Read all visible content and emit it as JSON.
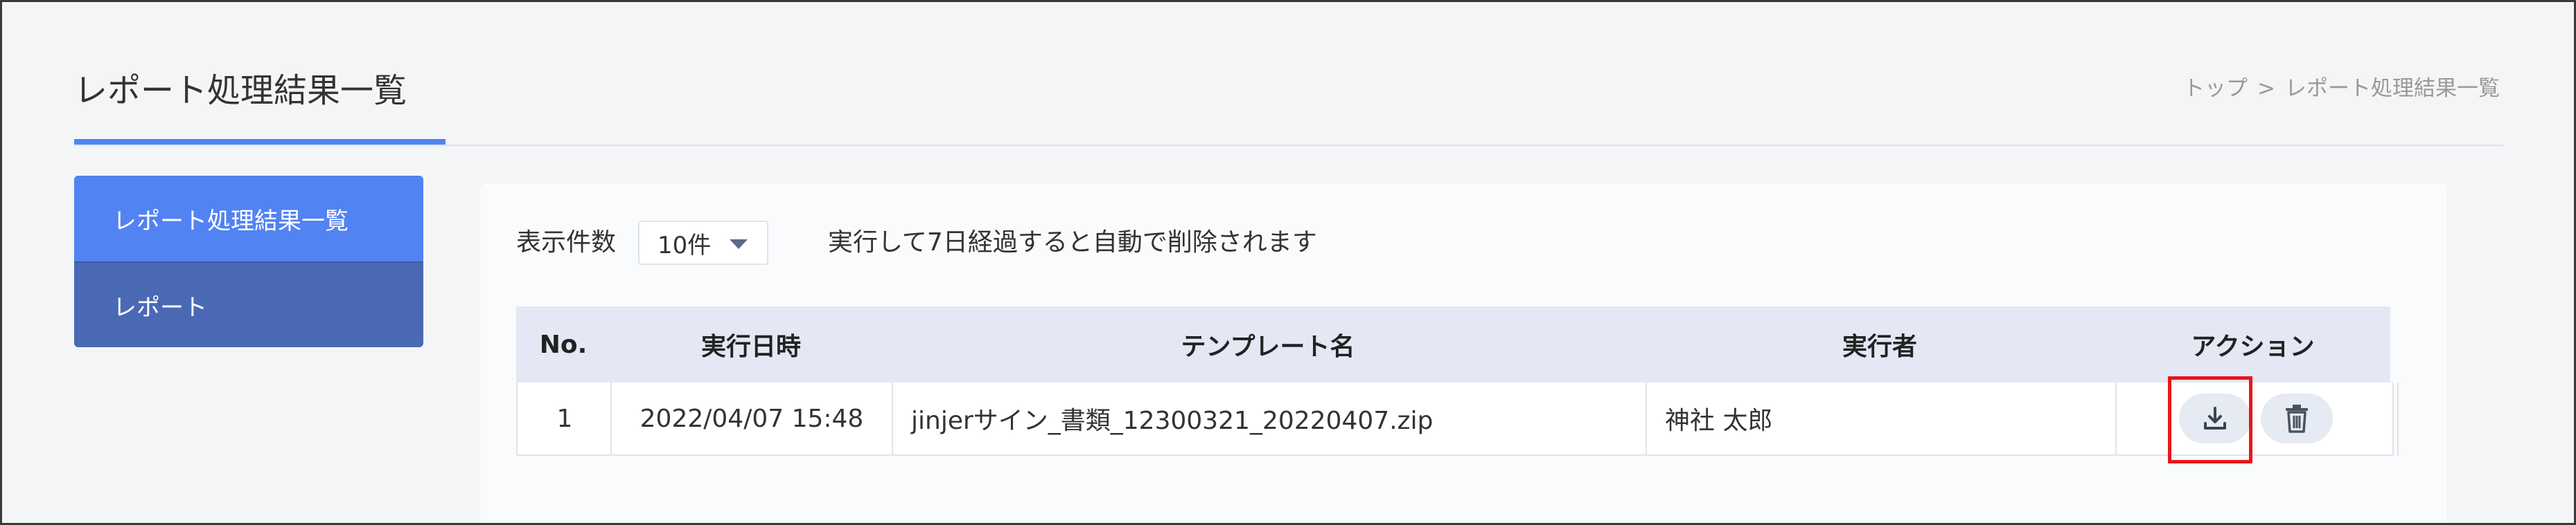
{
  "header": {
    "title": "レポート処理結果一覧",
    "breadcrumb": {
      "top": "トップ",
      "separator": ">",
      "current": "レポート処理結果一覧"
    }
  },
  "sidebar": {
    "items": [
      {
        "label": "レポート処理結果一覧",
        "active": true
      },
      {
        "label": "レポート",
        "active": false
      }
    ]
  },
  "toolbar": {
    "display_count_label": "表示件数",
    "display_count_value": "10件",
    "notice": "実行して7日経過すると自動で削除されます"
  },
  "table": {
    "headers": {
      "no": "No.",
      "executed_at": "実行日時",
      "template_name": "テンプレート名",
      "executor": "実行者",
      "action": "アクション"
    },
    "rows": [
      {
        "no": "1",
        "executed_at": "2022/04/07 15:48",
        "template_name": "jinjerサイン_書類_12300321_20220407.zip",
        "executor": "神社 太郎"
      }
    ]
  },
  "icons": {
    "download": "download-icon",
    "delete": "trash-icon",
    "dropdown": "caret-down-icon"
  },
  "colors": {
    "accent": "#5283f3",
    "sidebar_secondary": "#4a69b5",
    "table_header": "#e3e8f4",
    "highlight": "#e8151b"
  }
}
